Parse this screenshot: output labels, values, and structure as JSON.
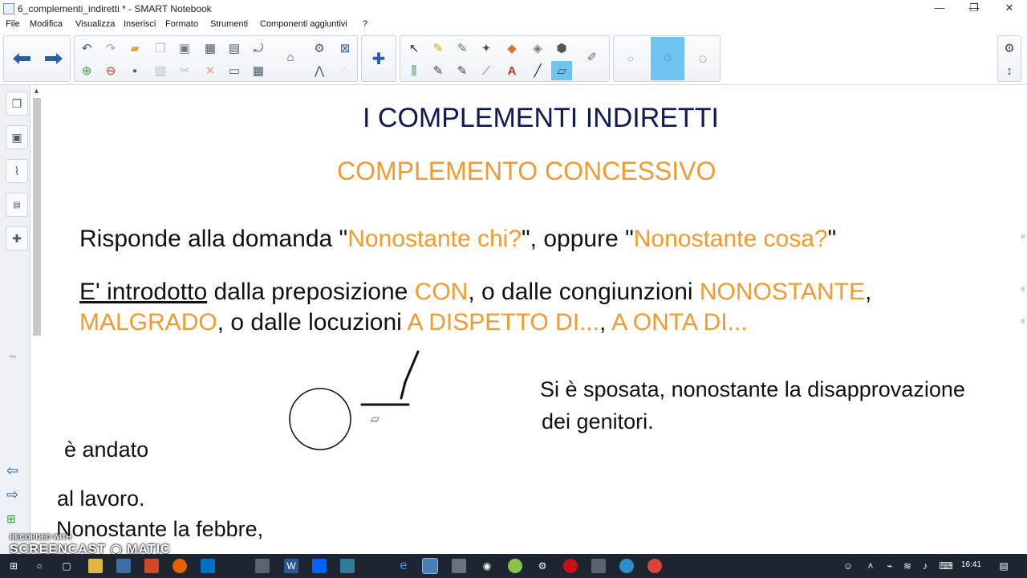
{
  "window": {
    "title": "6_complementi_indiretti * - SMART Notebook",
    "minimize_glyph": "—",
    "restore_glyph": "❐",
    "close_glyph": "✕"
  },
  "menu": {
    "items": [
      "File",
      "Modifica",
      "Visualizza",
      "Inserisci",
      "Formato",
      "Strumenti",
      "Componenti aggiuntivi",
      "?"
    ]
  },
  "toolbar": {
    "nav_icons": [
      "back-arrow-icon",
      "forward-arrow-icon"
    ],
    "file_icons": [
      "undo-icon",
      "redo-icon",
      "open-file-icon",
      "copy-icon",
      "paste-icon",
      "screen-capture-icon",
      "full-screen-icon",
      "rotate-icon",
      "add-page-icon",
      "delete-page-icon",
      "save-icon",
      "clone-icon",
      "cut-icon",
      "delete-icon",
      "screen-shade-icon",
      "table-icon"
    ],
    "tool_icons": [
      "select-icon",
      "pen-icon",
      "creative-pen-icon",
      "magic-pen-icon",
      "fill-icon",
      "shapes-icon",
      "regular-polygon-icon",
      "calligraphy-icon",
      "highlighter-icon",
      "text-icon",
      "line-icon",
      "eraser-icon"
    ],
    "eraser_sizes": [
      "eraser-small-icon",
      "eraser-medium-icon",
      "eraser-large-icon"
    ],
    "eraser_selected": "eraser-medium-icon",
    "accent_color": "#6fc3f0"
  },
  "side_panel": {
    "tabs": [
      "page-sorter-icon",
      "gallery-icon",
      "attachments-icon",
      "properties-icon",
      "addons-icon"
    ]
  },
  "slide": {
    "title": "I COMPLEMENTI INDIRETTI",
    "subtitle": "COMPLEMENTO CONCESSIVO",
    "line1": {
      "a": "Risponde alla domanda \"",
      "b": "Nonostante chi?",
      "c": "\", oppure \"",
      "d": "Nonostante cosa?",
      "e": "\""
    },
    "line2": {
      "a": "E' introdotto",
      "b": " dalla preposizione ",
      "c": "CON",
      "d": ", o dalle congiunzioni ",
      "e": "NONOSTANTE",
      "f": ","
    },
    "line3": {
      "a": "MALGRADO",
      "b": ", o dalle locuzioni ",
      "c": "A DISPETTO DI...",
      "d": ", ",
      "e": "A ONTA DI..."
    },
    "example_line1": "Si è sposata, nonostante la disapprovazione",
    "example_line2": "dei genitori.",
    "fragment_andato": "è andato",
    "fragment_lavoro": "al lavoro.",
    "fragment_febbre": "Nonostante la febbre,",
    "colors": {
      "orange": "#f39a2b",
      "navy": "#0c1b57",
      "text": "#111111"
    }
  },
  "watermark": {
    "line1": "RECORDED WITH",
    "line2": "SCREENCAST",
    "line3": "MATIC"
  },
  "taskbar": {
    "apps": [
      "windows-start-icon",
      "cortana-icon",
      "task-view-icon",
      "file-explorer-icon",
      "store-icon",
      "office-icon",
      "firefox-icon",
      "outlook-icon",
      "notepad-icon",
      "word-icon",
      "dropbox-icon",
      "calendar-icon",
      "edge-icon",
      "smart-notebook-icon",
      "calculator-icon",
      "media-icon",
      "green-app-icon",
      "settings-icon",
      "opera-icon",
      "files-icon",
      "earth-icon",
      "chrome-icon"
    ],
    "tray_icons": [
      "people-icon",
      "chevron-up-icon",
      "network-icon",
      "wifi-icon",
      "windows-ink-icon",
      "speaker-icon",
      "keyboard-icon"
    ],
    "time": "16:41",
    "notification_icon": "action-center-icon"
  }
}
